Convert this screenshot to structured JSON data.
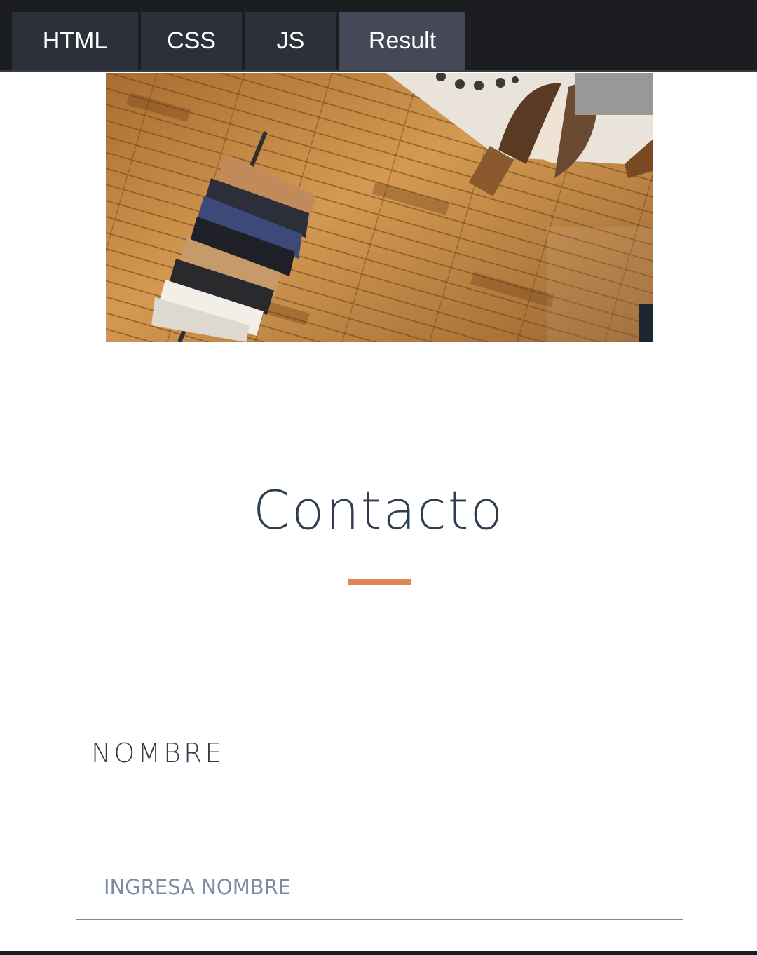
{
  "editor_tabs": {
    "html": "HTML",
    "css": "CSS",
    "js": "JS",
    "result": "Result",
    "active": "result"
  },
  "hero_image": {
    "icon": "clothing-store-photo"
  },
  "contact": {
    "title": "Contacto",
    "accent_color": "#dd8557",
    "name_label": "NOMBRE",
    "name_value": "",
    "name_placeholder": "INGRESA NOMBRE"
  }
}
